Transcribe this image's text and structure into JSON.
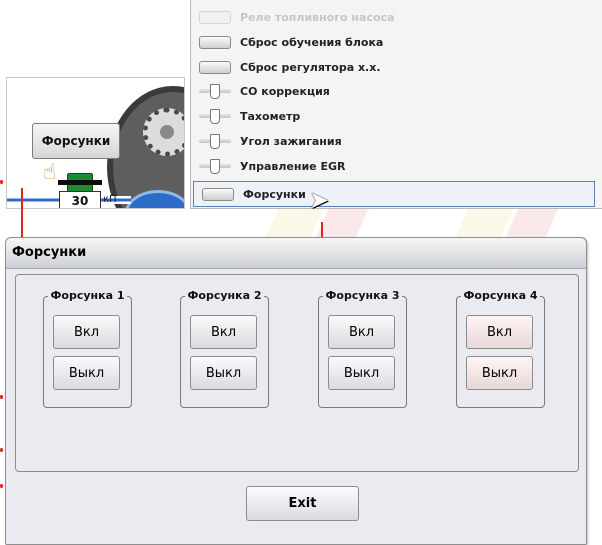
{
  "illustration": {
    "button_label": "Форсунки",
    "value": "30",
    "unit": "кП"
  },
  "menu": {
    "items": [
      {
        "label": "Реле топливного насоса",
        "indicator": "led",
        "state": "faded"
      },
      {
        "label": "Сброс обучения блока",
        "indicator": "led",
        "state": "normal"
      },
      {
        "label": "Сброс регулятора х.х.",
        "indicator": "led",
        "state": "normal"
      },
      {
        "label": "CO коррекция",
        "indicator": "valve",
        "state": "normal"
      },
      {
        "label": "Тахометр",
        "indicator": "valve",
        "state": "normal"
      },
      {
        "label": "Угол зажигания",
        "indicator": "valve",
        "state": "normal"
      },
      {
        "label": "Управление EGR",
        "indicator": "valve",
        "state": "normal"
      },
      {
        "label": "Форсунки",
        "indicator": "led",
        "state": "selected"
      }
    ]
  },
  "dialog": {
    "title": "Форсунки",
    "injectors": [
      {
        "title": "Форсунка 1",
        "on_label": "Вкл",
        "off_label": "Выкл"
      },
      {
        "title": "Форсунка 2",
        "on_label": "Вкл",
        "off_label": "Выкл"
      },
      {
        "title": "Форсунка 3",
        "on_label": "Вкл",
        "off_label": "Выкл"
      },
      {
        "title": "Форсунка 4",
        "on_label": "Вкл",
        "off_label": "Выкл"
      }
    ],
    "exit_label": "Exit"
  },
  "colors": {
    "arrow": "#e2231a",
    "selection_border": "#5b7fb5",
    "dialog_background": "#e9ebf0"
  },
  "icons": [
    "hand-pointer-icon",
    "arrow-cursor-icon",
    "gear-icon",
    "nozzle-icon",
    "led-indicator-icon",
    "valve-indicator-icon"
  ]
}
